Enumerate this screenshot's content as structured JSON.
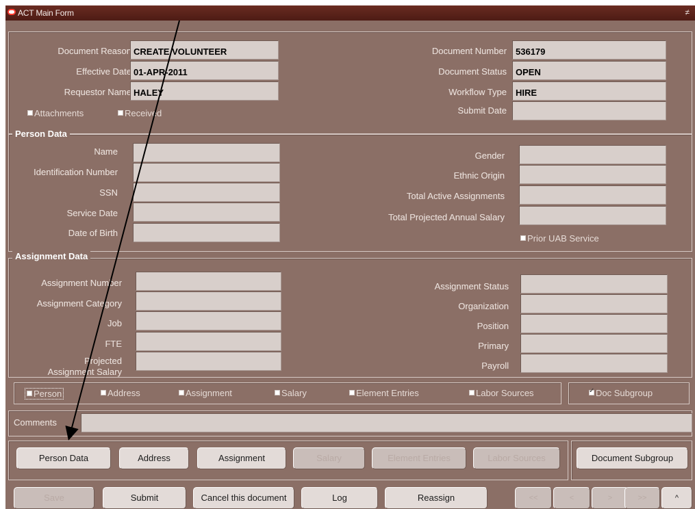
{
  "window": {
    "title": "ACT Main Form",
    "restore_glyph": "≠"
  },
  "header": {
    "document_reason": {
      "label": "Document Reason",
      "value": "CREATE VOLUNTEER"
    },
    "effective_date": {
      "label": "Effective Date",
      "value": "01-APR-2011"
    },
    "requestor_name": {
      "label": "Requestor Name",
      "value": "HALEY"
    },
    "document_number": {
      "label": "Document Number",
      "value": "536179"
    },
    "document_status": {
      "label": "Document Status",
      "value": "OPEN"
    },
    "workflow_type": {
      "label": "Workflow Type",
      "value": "HIRE"
    },
    "submit_date": {
      "label": "Submit Date",
      "value": ""
    },
    "attachments_label": "Attachments",
    "received_label": "Received"
  },
  "person": {
    "title": "Person Data",
    "name_label": "Name",
    "id_label": "Identification Number",
    "ssn_label": "SSN",
    "service_date_label": "Service Date",
    "dob_label": "Date of Birth",
    "gender_label": "Gender",
    "ethnic_label": "Ethnic Origin",
    "active_assign_label": "Total Active Assignments",
    "projected_salary_label": "Total Projected Annual Salary",
    "prior_uab_label": "Prior UAB Service"
  },
  "assignment": {
    "title": "Assignment Data",
    "number_label": "Assignment Number",
    "category_label": "Assignment Category",
    "job_label": "Job",
    "fte_label": "FTE",
    "projected_label_1": "Projected",
    "projected_label_2": "Assignment Salary",
    "status_label": "Assignment Status",
    "organization_label": "Organization",
    "position_label": "Position",
    "primary_label": "Primary",
    "payroll_label": "Payroll"
  },
  "tabs": {
    "person": "Person",
    "address": "Address",
    "assignment": "Assignment",
    "salary": "Salary",
    "element_entries": "Element Entries",
    "labor_sources": "Labor Sources",
    "doc_subgroup": "Doc Subgroup"
  },
  "comments": {
    "label": "Comments"
  },
  "buttons": {
    "person_data": "Person Data",
    "address": "Address",
    "assignment": "Assignment",
    "salary": "Salary",
    "element_entries": "Element Entries",
    "labor_sources": "Labor Sources",
    "document_subgroup": "Document Subgroup",
    "save": "Save",
    "submit": "Submit",
    "cancel_document": "Cancel this document",
    "log": "Log",
    "reassign": "Reassign",
    "first": "<<",
    "prev": "<",
    "next": ">",
    "last": ">>",
    "extra": "^"
  },
  "colors": {
    "form_bg": "#8b6f66",
    "title_bar": "#5a2219",
    "field_bg": "#d8cfcb",
    "button_bg": "#e3dbd8"
  }
}
